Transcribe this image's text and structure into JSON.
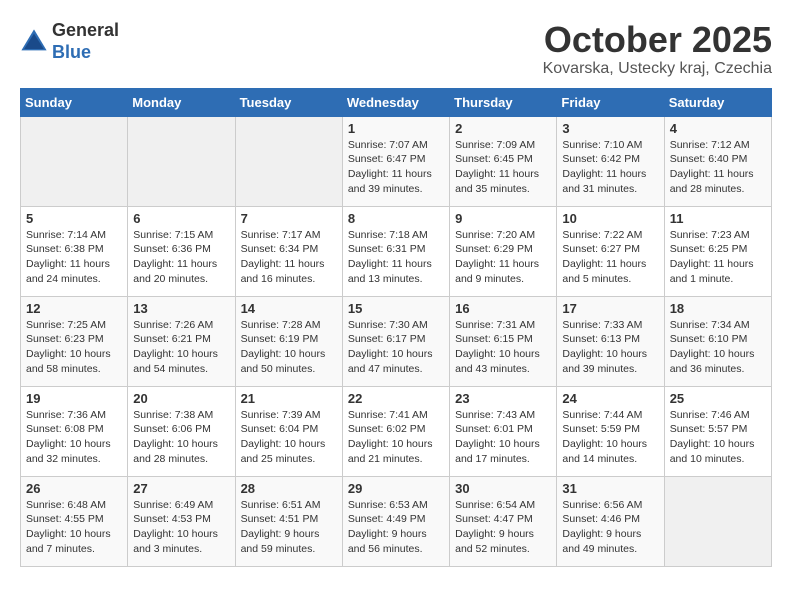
{
  "header": {
    "logo_general": "General",
    "logo_blue": "Blue",
    "month_title": "October 2025",
    "location": "Kovarska, Ustecky kraj, Czechia"
  },
  "days_of_week": [
    "Sunday",
    "Monday",
    "Tuesday",
    "Wednesday",
    "Thursday",
    "Friday",
    "Saturday"
  ],
  "weeks": [
    [
      {
        "day": "",
        "info": ""
      },
      {
        "day": "",
        "info": ""
      },
      {
        "day": "",
        "info": ""
      },
      {
        "day": "1",
        "info": "Sunrise: 7:07 AM\nSunset: 6:47 PM\nDaylight: 11 hours\nand 39 minutes."
      },
      {
        "day": "2",
        "info": "Sunrise: 7:09 AM\nSunset: 6:45 PM\nDaylight: 11 hours\nand 35 minutes."
      },
      {
        "day": "3",
        "info": "Sunrise: 7:10 AM\nSunset: 6:42 PM\nDaylight: 11 hours\nand 31 minutes."
      },
      {
        "day": "4",
        "info": "Sunrise: 7:12 AM\nSunset: 6:40 PM\nDaylight: 11 hours\nand 28 minutes."
      }
    ],
    [
      {
        "day": "5",
        "info": "Sunrise: 7:14 AM\nSunset: 6:38 PM\nDaylight: 11 hours\nand 24 minutes."
      },
      {
        "day": "6",
        "info": "Sunrise: 7:15 AM\nSunset: 6:36 PM\nDaylight: 11 hours\nand 20 minutes."
      },
      {
        "day": "7",
        "info": "Sunrise: 7:17 AM\nSunset: 6:34 PM\nDaylight: 11 hours\nand 16 minutes."
      },
      {
        "day": "8",
        "info": "Sunrise: 7:18 AM\nSunset: 6:31 PM\nDaylight: 11 hours\nand 13 minutes."
      },
      {
        "day": "9",
        "info": "Sunrise: 7:20 AM\nSunset: 6:29 PM\nDaylight: 11 hours\nand 9 minutes."
      },
      {
        "day": "10",
        "info": "Sunrise: 7:22 AM\nSunset: 6:27 PM\nDaylight: 11 hours\nand 5 minutes."
      },
      {
        "day": "11",
        "info": "Sunrise: 7:23 AM\nSunset: 6:25 PM\nDaylight: 11 hours\nand 1 minute."
      }
    ],
    [
      {
        "day": "12",
        "info": "Sunrise: 7:25 AM\nSunset: 6:23 PM\nDaylight: 10 hours\nand 58 minutes."
      },
      {
        "day": "13",
        "info": "Sunrise: 7:26 AM\nSunset: 6:21 PM\nDaylight: 10 hours\nand 54 minutes."
      },
      {
        "day": "14",
        "info": "Sunrise: 7:28 AM\nSunset: 6:19 PM\nDaylight: 10 hours\nand 50 minutes."
      },
      {
        "day": "15",
        "info": "Sunrise: 7:30 AM\nSunset: 6:17 PM\nDaylight: 10 hours\nand 47 minutes."
      },
      {
        "day": "16",
        "info": "Sunrise: 7:31 AM\nSunset: 6:15 PM\nDaylight: 10 hours\nand 43 minutes."
      },
      {
        "day": "17",
        "info": "Sunrise: 7:33 AM\nSunset: 6:13 PM\nDaylight: 10 hours\nand 39 minutes."
      },
      {
        "day": "18",
        "info": "Sunrise: 7:34 AM\nSunset: 6:10 PM\nDaylight: 10 hours\nand 36 minutes."
      }
    ],
    [
      {
        "day": "19",
        "info": "Sunrise: 7:36 AM\nSunset: 6:08 PM\nDaylight: 10 hours\nand 32 minutes."
      },
      {
        "day": "20",
        "info": "Sunrise: 7:38 AM\nSunset: 6:06 PM\nDaylight: 10 hours\nand 28 minutes."
      },
      {
        "day": "21",
        "info": "Sunrise: 7:39 AM\nSunset: 6:04 PM\nDaylight: 10 hours\nand 25 minutes."
      },
      {
        "day": "22",
        "info": "Sunrise: 7:41 AM\nSunset: 6:02 PM\nDaylight: 10 hours\nand 21 minutes."
      },
      {
        "day": "23",
        "info": "Sunrise: 7:43 AM\nSunset: 6:01 PM\nDaylight: 10 hours\nand 17 minutes."
      },
      {
        "day": "24",
        "info": "Sunrise: 7:44 AM\nSunset: 5:59 PM\nDaylight: 10 hours\nand 14 minutes."
      },
      {
        "day": "25",
        "info": "Sunrise: 7:46 AM\nSunset: 5:57 PM\nDaylight: 10 hours\nand 10 minutes."
      }
    ],
    [
      {
        "day": "26",
        "info": "Sunrise: 6:48 AM\nSunset: 4:55 PM\nDaylight: 10 hours\nand 7 minutes."
      },
      {
        "day": "27",
        "info": "Sunrise: 6:49 AM\nSunset: 4:53 PM\nDaylight: 10 hours\nand 3 minutes."
      },
      {
        "day": "28",
        "info": "Sunrise: 6:51 AM\nSunset: 4:51 PM\nDaylight: 9 hours\nand 59 minutes."
      },
      {
        "day": "29",
        "info": "Sunrise: 6:53 AM\nSunset: 4:49 PM\nDaylight: 9 hours\nand 56 minutes."
      },
      {
        "day": "30",
        "info": "Sunrise: 6:54 AM\nSunset: 4:47 PM\nDaylight: 9 hours\nand 52 minutes."
      },
      {
        "day": "31",
        "info": "Sunrise: 6:56 AM\nSunset: 4:46 PM\nDaylight: 9 hours\nand 49 minutes."
      },
      {
        "day": "",
        "info": ""
      }
    ]
  ]
}
